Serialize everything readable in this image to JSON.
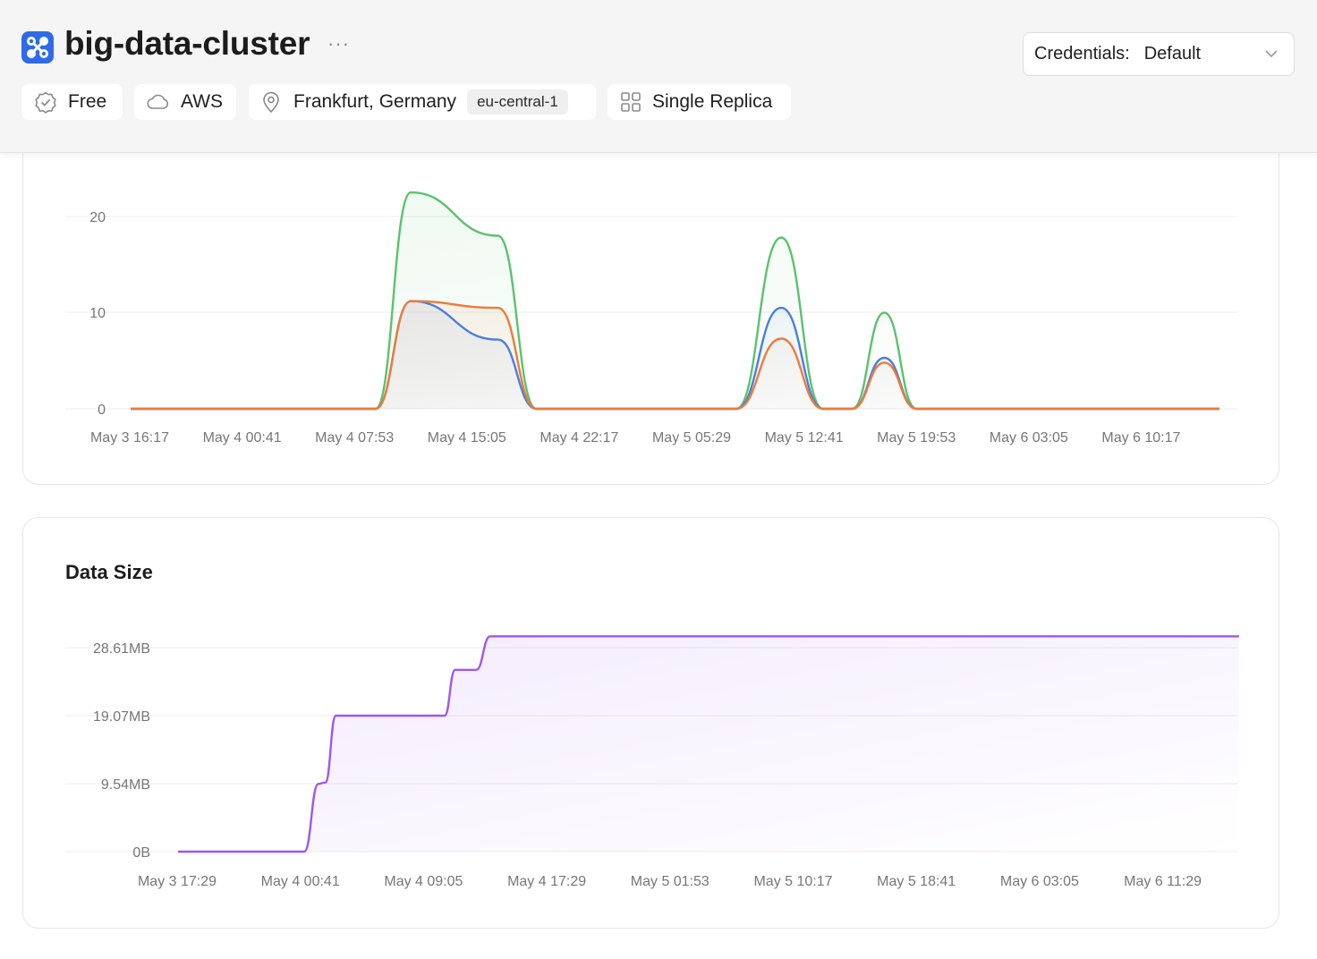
{
  "header": {
    "title": "big-data-cluster",
    "more_label": "···",
    "chips": {
      "tier": "Free",
      "provider": "AWS",
      "location": "Frankfurt, Germany",
      "region": "eu-central-1",
      "replica": "Single Replica"
    },
    "credentials": {
      "label": "Credentials:",
      "value": "Default"
    }
  },
  "icons": {
    "logo": "cluster-logo-icon",
    "tier": "check-badge-icon",
    "provider": "cloud-icon",
    "location": "map-pin-icon",
    "replica": "grid-icon",
    "credentials": "chevron-down-icon"
  },
  "colors": {
    "brand": "#2f6be8",
    "series_green": "#5cc26e",
    "series_blue": "#4a7de0",
    "series_orange": "#ed7b3a",
    "data_size": "#9b59f0"
  },
  "chart_data": [
    {
      "type": "line",
      "title": "",
      "x_ticks": [
        "May 3 16:17",
        "May 4 00:41",
        "May 4 07:53",
        "May 4 15:05",
        "May 4 22:17",
        "May 5 05:29",
        "May 5 12:41",
        "May 5 19:53",
        "May 6 03:05",
        "May 6 10:17"
      ],
      "y_ticks": [
        "20",
        "10",
        "0"
      ],
      "ylim": [
        0,
        25
      ],
      "grid": true,
      "series": [
        {
          "color": "#5cc26e",
          "points": [
            [
              0,
              0
            ],
            [
              3.8,
              0
            ],
            [
              4.35,
              22.5
            ],
            [
              5.7,
              18
            ],
            [
              6.3,
              0
            ],
            [
              9.4,
              0
            ],
            [
              10.1,
              17.8
            ],
            [
              10.75,
              0
            ],
            [
              11.2,
              0
            ],
            [
              11.7,
              10
            ],
            [
              12.2,
              0
            ],
            [
              16.9,
              0
            ]
          ]
        },
        {
          "color": "#4a7de0",
          "points": [
            [
              0,
              0
            ],
            [
              3.8,
              0
            ],
            [
              4.35,
              11.2
            ],
            [
              5.7,
              7.2
            ],
            [
              6.3,
              0
            ],
            [
              9.4,
              0
            ],
            [
              10.1,
              10.5
            ],
            [
              10.75,
              0
            ],
            [
              11.2,
              0
            ],
            [
              11.7,
              5.3
            ],
            [
              12.2,
              0
            ],
            [
              16.9,
              0
            ]
          ]
        },
        {
          "color": "#ed7b3a",
          "points": [
            [
              0,
              0
            ],
            [
              3.8,
              0
            ],
            [
              4.35,
              11.2
            ],
            [
              5.7,
              10.5
            ],
            [
              6.3,
              0
            ],
            [
              9.4,
              0
            ],
            [
              10.1,
              7.3
            ],
            [
              10.75,
              0
            ],
            [
              11.2,
              0
            ],
            [
              11.7,
              4.8
            ],
            [
              12.2,
              0
            ],
            [
              16.9,
              0
            ]
          ]
        }
      ]
    },
    {
      "type": "area",
      "title": "Data Size",
      "x_ticks": [
        "May 3 17:29",
        "May 4 00:41",
        "May 4 09:05",
        "May 4 17:29",
        "May 5 01:53",
        "May 5 10:17",
        "May 5 18:41",
        "May 6 03:05",
        "May 6 11:29"
      ],
      "y_ticks": [
        "28.61MB",
        "19.07MB",
        "9.54MB",
        "0B"
      ],
      "ylim": [
        0,
        31
      ],
      "grid": true,
      "series": [
        {
          "color": "#9b59f0",
          "points": [
            [
              0,
              0
            ],
            [
              7.2,
              0
            ],
            [
              8.0,
              9.5
            ],
            [
              8.4,
              9.7
            ],
            [
              9.0,
              19.07
            ],
            [
              15.2,
              19.07
            ],
            [
              15.8,
              25.5
            ],
            [
              17.0,
              25.5
            ],
            [
              17.8,
              30.2
            ],
            [
              60.5,
              30.2
            ]
          ]
        }
      ]
    }
  ]
}
